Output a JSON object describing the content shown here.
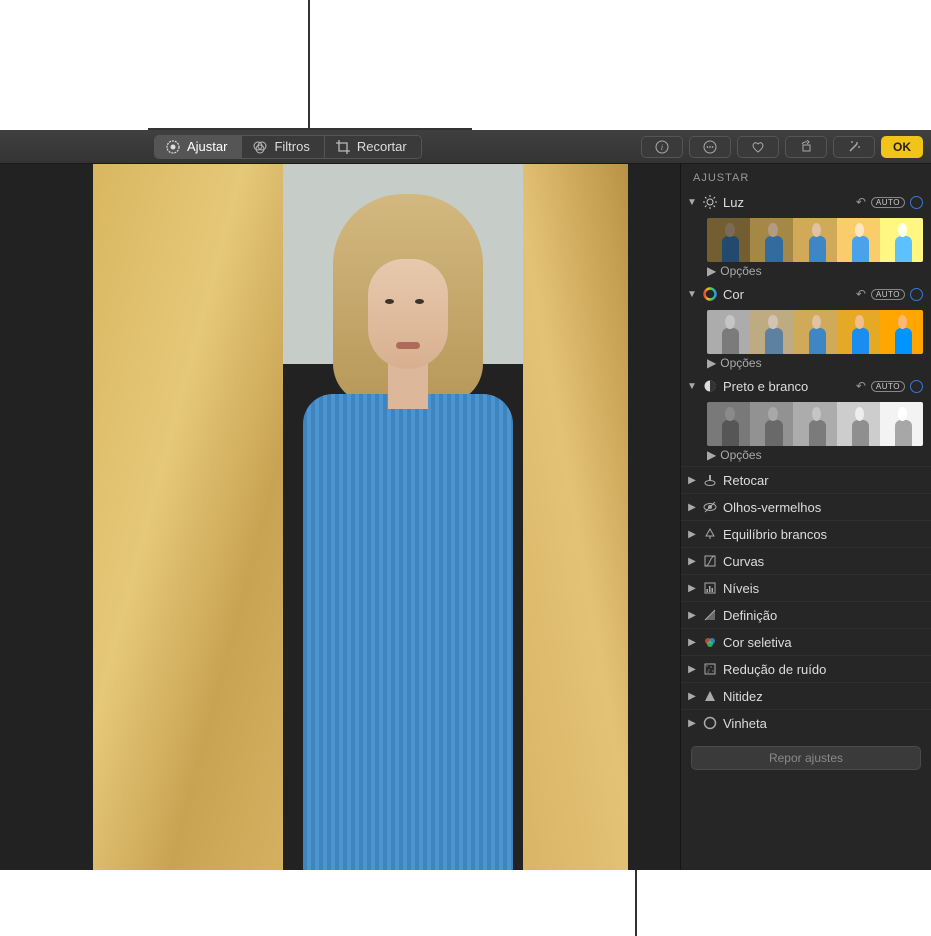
{
  "toolbar": {
    "tabs": {
      "adjust": "Ajustar",
      "filters": "Filtros",
      "crop": "Recortar"
    },
    "ok_label": "OK"
  },
  "sidebar": {
    "title": "AJUSTAR",
    "expanded_groups": [
      {
        "key": "light",
        "label": "Luz",
        "options_label": "Opções",
        "auto": "AUTO"
      },
      {
        "key": "color",
        "label": "Cor",
        "options_label": "Opções",
        "auto": "AUTO"
      },
      {
        "key": "bw",
        "label": "Preto e branco",
        "options_label": "Opções",
        "auto": "AUTO"
      }
    ],
    "collapsed_groups": [
      {
        "key": "retouch",
        "label": "Retocar"
      },
      {
        "key": "redeye",
        "label": "Olhos-vermelhos"
      },
      {
        "key": "whitebalance",
        "label": "Equilíbrio brancos"
      },
      {
        "key": "curves",
        "label": "Curvas"
      },
      {
        "key": "levels",
        "label": "Níveis"
      },
      {
        "key": "definition",
        "label": "Definição"
      },
      {
        "key": "selectivecolor",
        "label": "Cor seletiva"
      },
      {
        "key": "noise",
        "label": "Redução de ruído"
      },
      {
        "key": "sharpen",
        "label": "Nitidez"
      },
      {
        "key": "vignette",
        "label": "Vinheta"
      }
    ],
    "reset_label": "Repor ajustes"
  }
}
